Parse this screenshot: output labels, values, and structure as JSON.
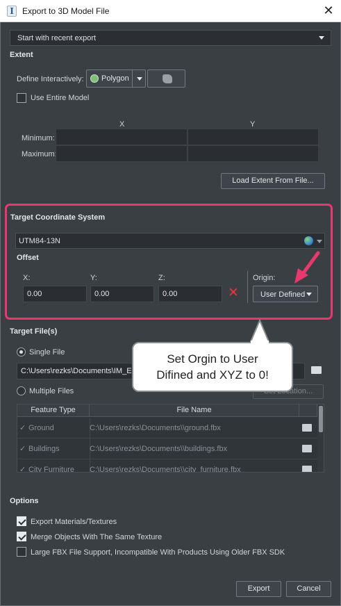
{
  "window": {
    "title": "Export to 3D Model File",
    "close_label": "✕"
  },
  "recent_export": {
    "selected": "Start with recent export"
  },
  "extent": {
    "title": "Extent",
    "define_label": "Define Interactively:",
    "mode_selected": "Polygon",
    "use_entire_model_label": "Use Entire Model",
    "use_entire_model_checked": false,
    "col_x": "X",
    "col_y": "Y",
    "row_min": "Minimum:",
    "row_max": "Maximum:",
    "load_button": "Load Extent From File..."
  },
  "target_cs": {
    "title": "Target Coordinate System",
    "selected": "UTM84-13N",
    "offset_title": "Offset",
    "x_label": "X:",
    "y_label": "Y:",
    "z_label": "Z:",
    "x_value": "0.00",
    "y_value": "0.00",
    "z_value": "0.00",
    "origin_label": "Origin:",
    "origin_selected": "User Defined",
    "clear_icon": "✕"
  },
  "target_files": {
    "title": "Target File(s)",
    "single_label": "Single File",
    "single_path": "C:\\Users\\rezks\\Documents\\IM_E",
    "multiple_label": "Multiple Files",
    "set_location_button": "Set Location...",
    "col_feature_type": "Feature Type",
    "col_file_name": "File Name",
    "rows": [
      {
        "type": "Ground",
        "file": "C:\\Users\\rezks\\Documents\\\\ground.fbx"
      },
      {
        "type": "Buildings",
        "file": "C:\\Users\\rezks\\Documents\\\\buildings.fbx"
      },
      {
        "type": "City Furniture",
        "file": "C:\\Users\\rezks\\Documents\\\\city_furniture.fbx"
      }
    ]
  },
  "options": {
    "title": "Options",
    "export_materials_label": "Export Materials/Textures",
    "merge_objects_label": "Merge Objects With The Same Texture",
    "large_fbx_label": "Large FBX File Support, Incompatible With Products Using Older FBX SDK"
  },
  "footer": {
    "export_button": "Export",
    "cancel_button": "Cancel"
  },
  "callout": {
    "line1": "Set Orgin to User",
    "line2": "Difined and XYZ to 0!"
  },
  "colors": {
    "highlight": "#e8386d",
    "dialog_bg": "#3a3f44"
  }
}
